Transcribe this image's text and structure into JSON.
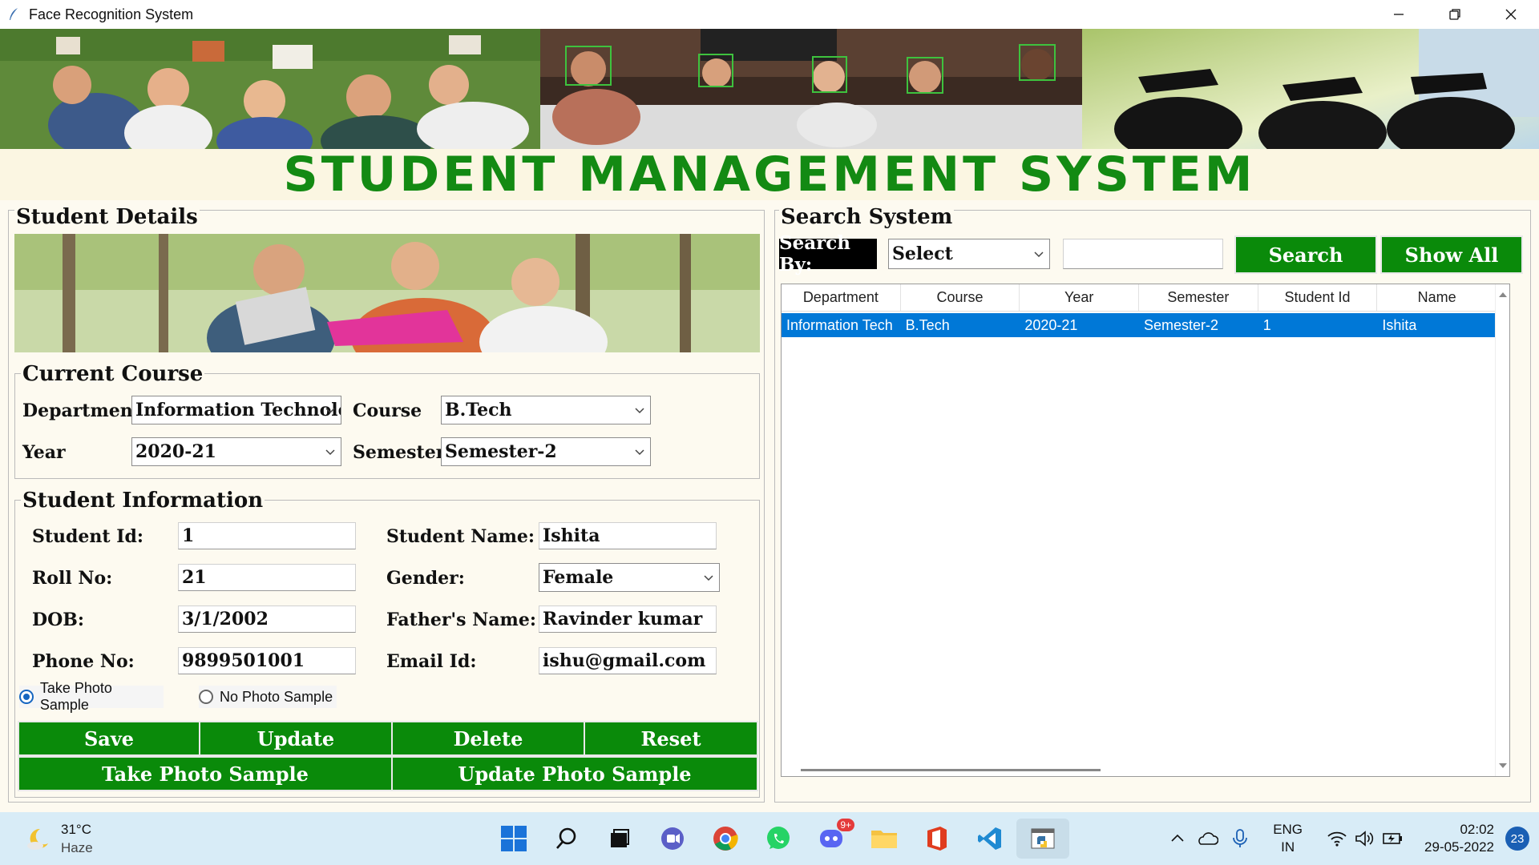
{
  "window": {
    "title": "Face Recognition System"
  },
  "headline": "STUDENT MANAGEMENT SYSTEM",
  "student_details": {
    "title": "Student Details",
    "current_course": {
      "title": "Current Course",
      "department_label": "Department",
      "department_value": "Information Technolog",
      "course_label": "Course",
      "course_value": "B.Tech",
      "year_label": "Year",
      "year_value": "2020-21",
      "semester_label": "Semester",
      "semester_value": "Semester-2"
    },
    "student_info": {
      "title": "Student Information",
      "student_id_label": "Student Id:",
      "student_id_value": "1",
      "student_name_label": "Student Name:",
      "student_name_value": "Ishita",
      "roll_no_label": "Roll No:",
      "roll_no_value": "21",
      "gender_label": "Gender:",
      "gender_value": "Female",
      "dob_label": "DOB:",
      "dob_value": "3/1/2002",
      "father_label": "Father's Name:",
      "father_value": "Ravinder kumar",
      "phone_label": "Phone No:",
      "phone_value": "9899501001",
      "email_label": "Email Id:",
      "email_value": "ishu@gmail.com",
      "radio_take": "Take Photo Sample",
      "radio_no": "No Photo Sample"
    },
    "buttons": {
      "save": "Save",
      "update": "Update",
      "delete": "Delete",
      "reset": "Reset",
      "take_photo": "Take Photo Sample",
      "update_photo": "Update Photo Sample"
    }
  },
  "search_system": {
    "title": "Search System",
    "search_by_label": "Search By:",
    "search_by_value": "Select",
    "search_text": "",
    "search_button": "Search",
    "show_all_button": "Show All",
    "table": {
      "columns": [
        "Department",
        "Course",
        "Year",
        "Semester",
        "Student Id",
        "Name"
      ],
      "rows": [
        [
          "Information Tech",
          "B.Tech",
          "2020-21",
          "Semester-2",
          "1",
          "Ishita"
        ]
      ]
    }
  },
  "taskbar": {
    "weather_temp": "31°C",
    "weather_cond": "Haze",
    "lang_1": "ENG",
    "lang_2": "IN",
    "time": "02:02",
    "date": "29-05-2022",
    "notifications": "23",
    "discord_badge": "9+"
  },
  "colors": {
    "accent_green": "#0a8a0a",
    "headline_green": "#138a13",
    "selection_blue": "#0078d7"
  }
}
